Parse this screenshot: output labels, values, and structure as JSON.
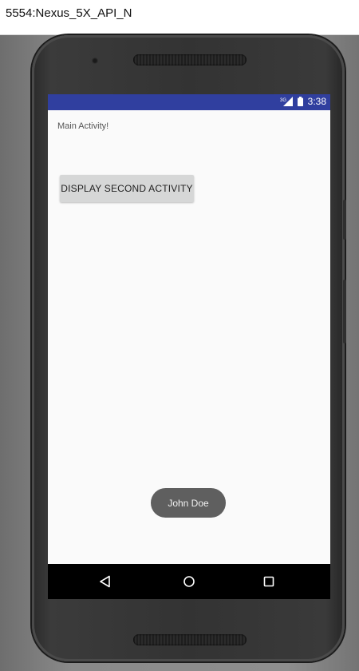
{
  "window": {
    "title": "5554:Nexus_5X_API_N"
  },
  "status_bar": {
    "network": "3G",
    "time": "3:38",
    "color": "#303f9f"
  },
  "app": {
    "main_text": "Main Activity!",
    "display_button_label": "DISPLAY SECOND ACTIVITY"
  },
  "toast": {
    "text": "John Doe"
  },
  "nav_bar": {
    "back": "back-icon",
    "home": "home-icon",
    "recents": "recents-icon"
  }
}
